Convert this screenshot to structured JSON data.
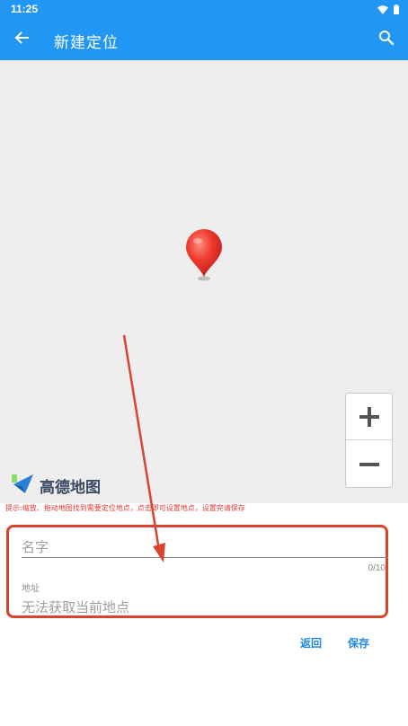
{
  "status_bar": {
    "time": "11:25",
    "icons": [
      "wifi-icon",
      "battery-icon"
    ]
  },
  "app_bar": {
    "title": "新建定位",
    "back_icon": "arrow-left-icon",
    "search_icon": "search-icon",
    "color": "#2196F3"
  },
  "map": {
    "provider_logo_text": "高德地图",
    "zoom_in_label": "+",
    "zoom_out_label": "−",
    "pin_icon": "map-pin-icon",
    "background": "#eeeeee"
  },
  "hint": {
    "text": "提示:缩放、拖动地图找到需要定位地点，点击即可设置地点，设置完请保存"
  },
  "form": {
    "name_placeholder": "名字",
    "name_value": "",
    "name_counter": "0/10",
    "address_label": "地址",
    "address_value": "无法获取当前地点"
  },
  "actions": {
    "back_label": "返回",
    "save_label": "保存"
  },
  "colors": {
    "accent": "#2196F3",
    "button_text": "#1e88e5",
    "annotation_red": "#d9442f",
    "hint_red": "#e53935"
  }
}
